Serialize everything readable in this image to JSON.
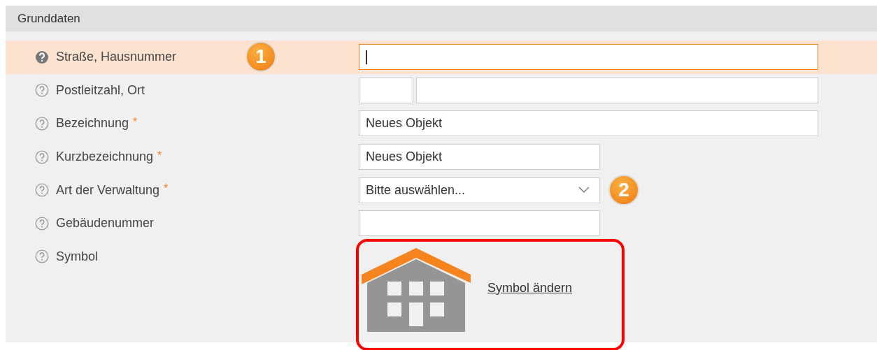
{
  "section": {
    "title": "Grunddaten"
  },
  "rows": [
    {
      "label": "Straße, Hausnummer",
      "kind": "wide-text",
      "focused": true,
      "callout": "1"
    },
    {
      "label": "Postleitzahl, Ort",
      "kind": "postal",
      "focused": false
    },
    {
      "label": "Bezeichnung",
      "required_mark": "*",
      "kind": "wide-text",
      "focused": false,
      "value": "Neues Objekt"
    },
    {
      "label": "Kurzbezeichnung",
      "required_mark": "*",
      "kind": "short-text",
      "focused": false,
      "value": "Neues Objekt"
    },
    {
      "label": "Art der Verwaltung",
      "required_mark": "*",
      "kind": "select",
      "focused": false,
      "value": "Bitte auswählen...",
      "callout": "2"
    },
    {
      "label": "Gebäudenummer",
      "kind": "short-text",
      "focused": false
    },
    {
      "label": "Symbol",
      "kind": "symbol",
      "focused": false,
      "outlined": true,
      "link": "Symbol ändern"
    }
  ]
}
